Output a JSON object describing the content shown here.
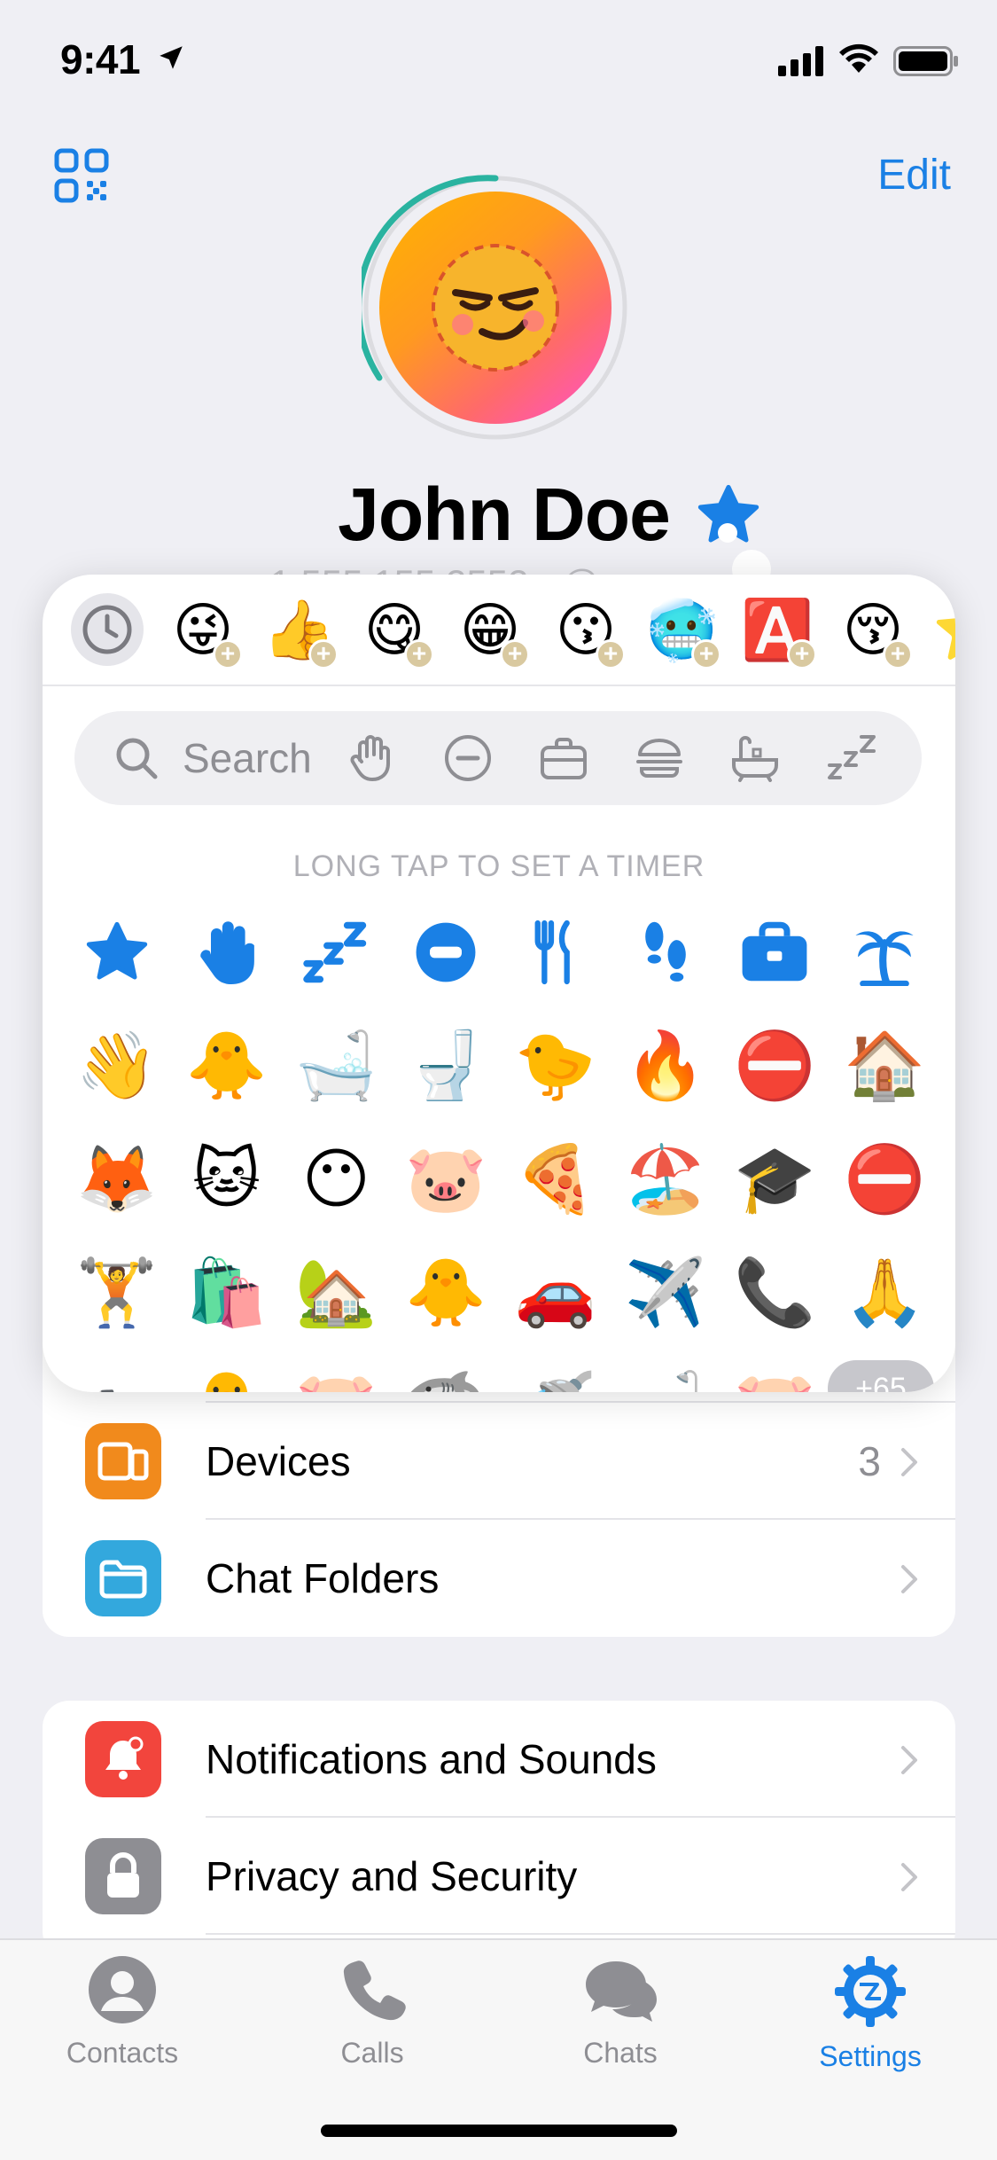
{
  "status": {
    "time": "9:41"
  },
  "header": {
    "edit_label": "Edit"
  },
  "profile": {
    "name": "John Doe",
    "phone_peek": "+1 555 155 2552 · @"
  },
  "emoji_panel": {
    "search_placeholder": "Search",
    "hint": "LONG TAP TO SET A TIMER",
    "more_count": "+65",
    "recent": [
      "😜",
      "👍",
      "😋",
      "😁",
      "😗",
      "🥶",
      "🅰️",
      "😚",
      "⭐"
    ],
    "grid": [
      "⭐",
      "👋",
      "💤",
      "⛔",
      "🍴",
      "👣",
      "💼",
      "🌴",
      "👋",
      "🐥",
      "🛁",
      "🚽",
      "🐤",
      "🔥",
      "⛔",
      "🏠",
      "🦊",
      "🐱",
      "😶",
      "🐷",
      "🍕",
      "🏖️",
      "🎓",
      "⛔",
      "🏋️",
      "🛍️",
      "🏡",
      "🐥",
      "🚗",
      "✈️",
      "📞",
      "🙏",
      "🚲",
      "🐥",
      "🐷",
      "🦈",
      "🚿",
      "🛁",
      "🐷",
      "🐥"
    ]
  },
  "settings": {
    "group1": [
      {
        "label": "Devices",
        "value": "3",
        "icon": "devices-icon",
        "color": "#f18a1c"
      },
      {
        "label": "Chat Folders",
        "value": "",
        "icon": "folder-icon",
        "color": "#33a8dd"
      }
    ],
    "group2": [
      {
        "label": "Notifications and Sounds",
        "icon": "bell-icon",
        "color": "#f2453d"
      },
      {
        "label": "Privacy and Security",
        "icon": "lock-icon",
        "color": "#8e8e93"
      }
    ]
  },
  "tabs": [
    {
      "label": "Contacts",
      "icon": "contacts-icon"
    },
    {
      "label": "Calls",
      "icon": "phone-icon"
    },
    {
      "label": "Chats",
      "icon": "chats-icon"
    },
    {
      "label": "Settings",
      "icon": "gear-icon",
      "active": true
    }
  ],
  "colors": {
    "accent": "#1a80e5",
    "background": "#efeff4"
  }
}
